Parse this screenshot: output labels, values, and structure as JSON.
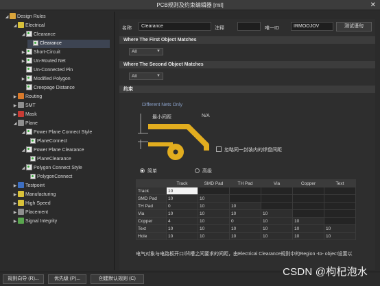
{
  "window": {
    "title": "PCB规则及约束编辑器 [mil]",
    "close": "✕"
  },
  "tree": {
    "items": [
      {
        "label": "Design Rules"
      },
      {
        "label": "Electrical"
      },
      {
        "label": "Clearance"
      },
      {
        "label": "Clearance"
      },
      {
        "label": "Short-Circuit"
      },
      {
        "label": "Un-Routed Net"
      },
      {
        "label": "Un-Connected Pin"
      },
      {
        "label": "Modified Polygon"
      },
      {
        "label": "Creepage Distance"
      },
      {
        "label": "Routing"
      },
      {
        "label": "SMT"
      },
      {
        "label": "Mask"
      },
      {
        "label": "Plane"
      },
      {
        "label": "Power Plane Connect Style"
      },
      {
        "label": "PlaneConnect"
      },
      {
        "label": "Power Plane Clearance"
      },
      {
        "label": "PlaneClearance"
      },
      {
        "label": "Polygon Connect Style"
      },
      {
        "label": "PolygonConnect"
      },
      {
        "label": "Testpoint"
      },
      {
        "label": "Manufacturing"
      },
      {
        "label": "High Speed"
      },
      {
        "label": "Placement"
      },
      {
        "label": "Signal Integrity"
      }
    ]
  },
  "rule": {
    "name_label": "名称",
    "name_value": "Clearance",
    "comment_label": "注释",
    "comment_value": "",
    "uid_label": "唯一ID",
    "uid_value": "IRMOOJOV",
    "test_button": "测试语句"
  },
  "first_match": {
    "title": "Where The First Object Matches",
    "value": "All"
  },
  "second_match": {
    "title": "Where The Second Object Matches",
    "value": "All"
  },
  "constraints": {
    "title": "约束",
    "different_nets": "Different Nets Only",
    "min_clearance_label": "最小间距",
    "min_clearance_value": "N/A",
    "ignore_pads_label": "忽略同一封装内的焊盘间距",
    "simple_label": "简单",
    "advanced_label": "高级"
  },
  "matrix": {
    "columns": [
      "Track",
      "SMD Pad",
      "TH Pad",
      "Via",
      "Copper",
      "Text"
    ],
    "rows": [
      {
        "name": "Track",
        "values": [
          "10",
          "",
          "",
          "",
          "",
          ""
        ]
      },
      {
        "name": "SMD Pad",
        "values": [
          "10",
          "10",
          "",
          "",
          "",
          ""
        ]
      },
      {
        "name": "TH Pad",
        "values": [
          "0",
          "10",
          "10",
          "",
          "",
          ""
        ]
      },
      {
        "name": "Via",
        "values": [
          "10",
          "10",
          "10",
          "10",
          "",
          ""
        ]
      },
      {
        "name": "Copper",
        "values": [
          "4",
          "10",
          "0",
          "10",
          "10",
          ""
        ]
      },
      {
        "name": "Text",
        "values": [
          "10",
          "10",
          "10",
          "10",
          "10",
          "10"
        ]
      },
      {
        "name": "Hole",
        "values": [
          "10",
          "10",
          "10",
          "10",
          "10",
          "10"
        ]
      }
    ]
  },
  "footer_text": "电气对象与电路板开口/凹槽之间要求的间距，由Electrical Clearance规则中的Region -to- object设置以",
  "buttons": {
    "wizard": "规则向导 (R)...",
    "priority": "优先级 (P)...",
    "create_default": "创建默认规则 (C)"
  },
  "watermark": "CSDN @枸杞泡水",
  "colors": {
    "accent_yellow": "#e2ad1f",
    "selected_row": "#3d4452"
  }
}
